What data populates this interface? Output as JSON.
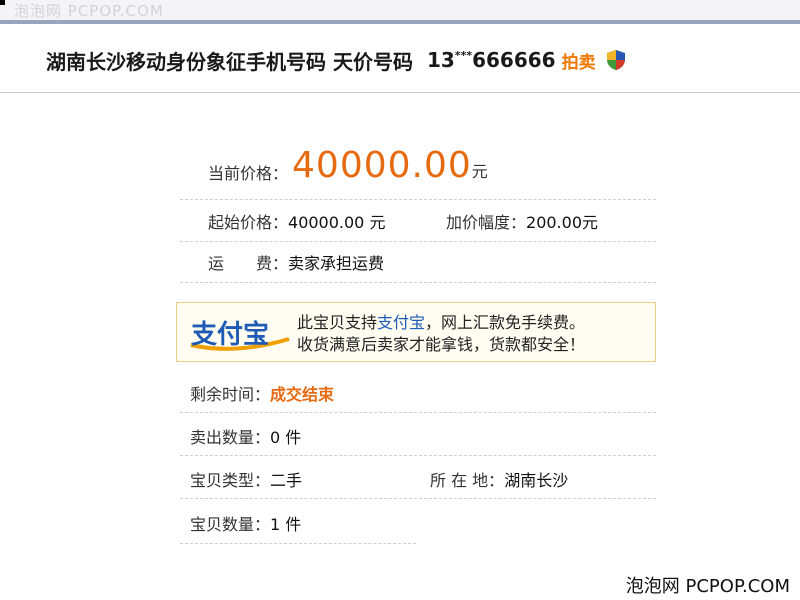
{
  "watermark": "泡泡网 PCPOP.COM",
  "header": {
    "title": "湖南长沙移动身份象征手机号码 天价号码",
    "number_prefix": "13",
    "number_mask": "***",
    "number_suffix": "666666",
    "auction_tag": "拍卖",
    "shield_icon": "shield-icon"
  },
  "price": {
    "current_label": "当前价格：",
    "current_value": "40000.00",
    "current_unit": "元",
    "start_label": "起始价格：",
    "start_value": "40000.00 元",
    "increment_label": "加价幅度：",
    "increment_value": "200.00元",
    "shipping_label": "运　　费：",
    "shipping_value": "卖家承担运费"
  },
  "alipay": {
    "logo_text": "支付宝",
    "line1_pre": "此宝贝支持",
    "line1_link": "支付宝",
    "line1_post": "，网上汇款免手续费。",
    "line2": "收货满意后卖家才能拿钱，货款都安全！"
  },
  "details": {
    "remaining_label": "剩余时间：",
    "remaining_value": "成交结束",
    "sold_label": "卖出数量：",
    "sold_value": "0 件",
    "type_label": "宝贝类型：",
    "type_value": "二手",
    "location_label": "所 在 地：",
    "location_value": "湖南长沙",
    "quantity_label": "宝贝数量：",
    "quantity_value": "1 件"
  },
  "footer": {
    "brand": "泡泡网 PCPOP.COM"
  },
  "colors": {
    "accent_orange": "#e66a10",
    "link_blue": "#1d5bb5",
    "alipay_border": "#e8cf86"
  }
}
